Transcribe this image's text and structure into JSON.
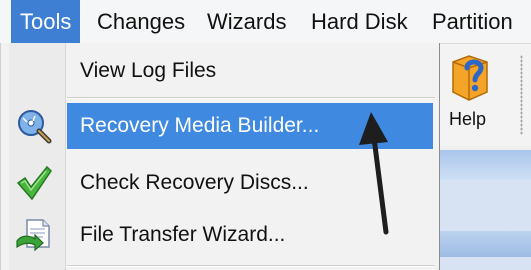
{
  "menubar": {
    "items": [
      {
        "label": "Tools",
        "active": true
      },
      {
        "label": "Changes"
      },
      {
        "label": "Wizards"
      },
      {
        "label": "Hard Disk"
      },
      {
        "label": "Partition"
      }
    ]
  },
  "dropdown": {
    "items": [
      {
        "label": "View Log Files",
        "icon": "none"
      },
      {
        "label": "Recovery Media Builder...",
        "icon": "disc-magnifier-icon",
        "highlighted": true
      },
      {
        "label": "Check Recovery Discs...",
        "icon": "checkmark-icon"
      },
      {
        "label": "File Transfer Wizard...",
        "icon": "file-transfer-icon"
      }
    ]
  },
  "toolbar": {
    "help_label": "Help",
    "help_icon": "help-icon"
  },
  "colors": {
    "menu_active": "#3f7fd3",
    "highlight": "#3f8ae0",
    "background": "#f2f2f2"
  }
}
